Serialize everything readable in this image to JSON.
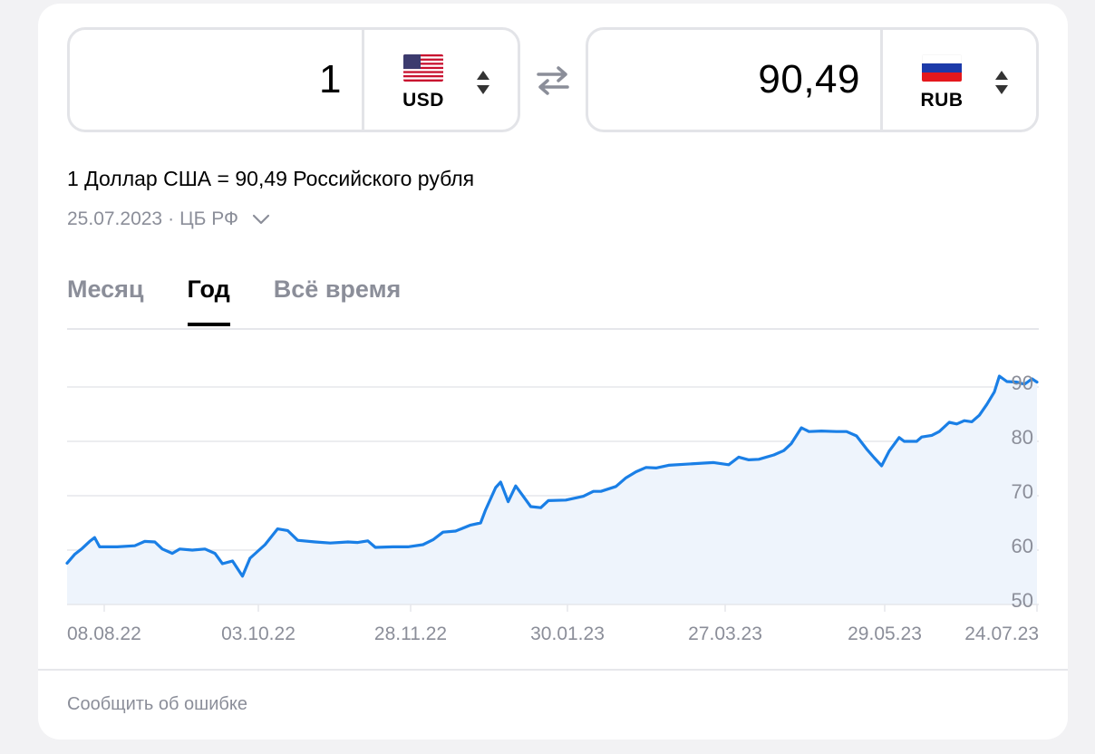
{
  "converter": {
    "from": {
      "amount": "1",
      "currency": "USD",
      "flag": "us-flag-icon"
    },
    "to": {
      "amount": "90,49",
      "currency": "RUB",
      "flag": "ru-flag-icon"
    },
    "swap_icon": "swap-arrows-icon"
  },
  "rate_text": "1 Доллар США = 90,49 Российского рубля",
  "meta": {
    "date": "25.07.2023",
    "source": "ЦБ РФ",
    "separator": " · "
  },
  "tabs": [
    {
      "label": "Месяц",
      "active": false
    },
    {
      "label": "Год",
      "active": true
    },
    {
      "label": "Всё время",
      "active": false
    }
  ],
  "footer": {
    "report_label": "Сообщить об ошибке"
  },
  "colors": {
    "line": "#1a7fe6",
    "area": "#eef4fc",
    "grid": "#e6e7eb",
    "muted": "#8b8e99"
  },
  "chart_data": {
    "type": "area",
    "x_ticks": [
      "08.08.22",
      "03.10.22",
      "28.11.22",
      "30.01.23",
      "27.03.23",
      "29.05.23",
      "24.07.23"
    ],
    "y_ticks": [
      50,
      60,
      70,
      80,
      90
    ],
    "ylim": [
      50,
      91
    ],
    "x_range": [
      "2022-07-26",
      "2023-07-25"
    ],
    "grid": true,
    "series": [
      {
        "values": [
          [
            "2022-07-26",
            57.6
          ],
          [
            "2022-07-29",
            59.2
          ],
          [
            "2022-08-01",
            60.3
          ],
          [
            "2022-08-04",
            61.6
          ],
          [
            "2022-08-06",
            62.3
          ],
          [
            "2022-08-08",
            60.6
          ],
          [
            "2022-08-15",
            60.6
          ],
          [
            "2022-08-22",
            60.8
          ],
          [
            "2022-08-26",
            61.6
          ],
          [
            "2022-08-30",
            61.5
          ],
          [
            "2022-09-02",
            60.2
          ],
          [
            "2022-09-06",
            59.4
          ],
          [
            "2022-09-09",
            60.2
          ],
          [
            "2022-09-14",
            60.0
          ],
          [
            "2022-09-19",
            60.2
          ],
          [
            "2022-09-23",
            59.4
          ],
          [
            "2022-09-26",
            57.5
          ],
          [
            "2022-09-30",
            58.0
          ],
          [
            "2022-10-04",
            55.2
          ],
          [
            "2022-10-07",
            58.5
          ],
          [
            "2022-10-13",
            61.0
          ],
          [
            "2022-10-18",
            63.9
          ],
          [
            "2022-10-22",
            63.6
          ],
          [
            "2022-10-26",
            61.8
          ],
          [
            "2022-11-02",
            61.5
          ],
          [
            "2022-11-08",
            61.3
          ],
          [
            "2022-11-15",
            61.5
          ],
          [
            "2022-11-19",
            61.4
          ],
          [
            "2022-11-23",
            61.7
          ],
          [
            "2022-11-26",
            60.5
          ],
          [
            "2022-12-03",
            60.6
          ],
          [
            "2022-12-09",
            60.6
          ],
          [
            "2022-12-15",
            61.0
          ],
          [
            "2022-12-19",
            61.9
          ],
          [
            "2022-12-23",
            63.3
          ],
          [
            "2022-12-28",
            63.5
          ],
          [
            "2023-01-03",
            64.6
          ],
          [
            "2023-01-07",
            65.0
          ],
          [
            "2023-01-09",
            67.4
          ],
          [
            "2023-01-13",
            71.5
          ],
          [
            "2023-01-15",
            72.5
          ],
          [
            "2023-01-18",
            68.9
          ],
          [
            "2023-01-21",
            71.8
          ],
          [
            "2023-01-24",
            69.9
          ],
          [
            "2023-01-27",
            68.0
          ],
          [
            "2023-01-31",
            67.8
          ],
          [
            "2023-02-03",
            69.1
          ],
          [
            "2023-02-10",
            69.2
          ],
          [
            "2023-02-17",
            69.9
          ],
          [
            "2023-02-21",
            70.8
          ],
          [
            "2023-02-24",
            70.8
          ],
          [
            "2023-03-02",
            71.7
          ],
          [
            "2023-03-06",
            73.3
          ],
          [
            "2023-03-10",
            74.4
          ],
          [
            "2023-03-14",
            75.2
          ],
          [
            "2023-03-18",
            75.1
          ],
          [
            "2023-03-23",
            75.6
          ],
          [
            "2023-03-30",
            75.8
          ],
          [
            "2023-04-06",
            76.0
          ],
          [
            "2023-04-10",
            76.1
          ],
          [
            "2023-04-16",
            75.7
          ],
          [
            "2023-04-20",
            77.1
          ],
          [
            "2023-04-24",
            76.6
          ],
          [
            "2023-04-28",
            76.7
          ],
          [
            "2023-05-04",
            77.5
          ],
          [
            "2023-05-08",
            78.3
          ],
          [
            "2023-05-11",
            79.6
          ],
          [
            "2023-05-15",
            82.5
          ],
          [
            "2023-05-18",
            81.8
          ],
          [
            "2023-05-23",
            81.9
          ],
          [
            "2023-05-29",
            81.8
          ],
          [
            "2023-06-02",
            81.8
          ],
          [
            "2023-06-06",
            81.0
          ],
          [
            "2023-06-10",
            78.6
          ],
          [
            "2023-06-13",
            77.0
          ],
          [
            "2023-06-16",
            75.5
          ],
          [
            "2023-06-19",
            78.2
          ],
          [
            "2023-06-23",
            80.7
          ],
          [
            "2023-06-25",
            80.0
          ],
          [
            "2023-06-30",
            80.0
          ],
          [
            "2023-07-02",
            80.8
          ],
          [
            "2023-07-06",
            81.1
          ],
          [
            "2023-07-09",
            81.8
          ],
          [
            "2023-07-13",
            83.5
          ],
          [
            "2023-07-16",
            83.2
          ],
          [
            "2023-07-19",
            83.8
          ],
          [
            "2023-07-22",
            83.6
          ],
          [
            "2023-07-25",
            84.8
          ],
          [
            "2023-07-28",
            86.8
          ],
          [
            "2023-07-31",
            89.1
          ],
          [
            "2023-08-02",
            92.0
          ],
          [
            "2023-08-05",
            91.0
          ],
          [
            "2023-08-09",
            90.9
          ],
          [
            "2023-08-12",
            90.5
          ],
          [
            "2023-08-15",
            91.5
          ],
          [
            "2023-08-17",
            90.9
          ]
        ]
      }
    ]
  }
}
